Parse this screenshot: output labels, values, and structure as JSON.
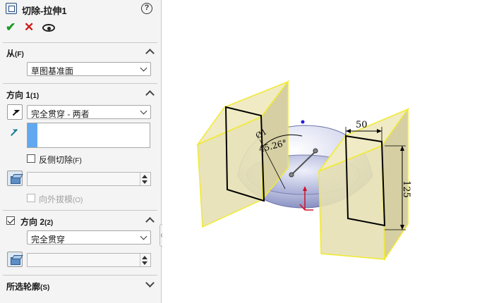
{
  "panel": {
    "title": "切除-拉伸1",
    "help_symbol": "?",
    "ok_symbol": "✔",
    "cancel_symbol": "✕",
    "from": {
      "label": "从",
      "shortcut": "(F)",
      "value": "草图基准面"
    },
    "direction1": {
      "label": "方向 1",
      "shortcut": "(1)",
      "end_condition": "完全贯穿 - 两者",
      "flip_side_label": "反侧切除",
      "flip_side_shortcut": "(F)",
      "flip_side_checked": false,
      "draft_outward_label": "向外拔模",
      "draft_outward_shortcut": "(O)",
      "draft_outward_enabled": false
    },
    "direction2": {
      "label": "方向 2",
      "shortcut": "(2)",
      "checked": true,
      "end_condition": "完全贯穿"
    },
    "selected_contours": {
      "label": "所选轮廓",
      "shortcut": "(S)"
    }
  },
  "viewport": {
    "dimensions": {
      "width": "50",
      "height": "125",
      "angle": "45.26°",
      "diameter_prefix": "Ø1"
    },
    "colors": {
      "block_fill": "#e9e3b8",
      "block_edge": "#f3ec3a",
      "sketch_line": "#000000",
      "dome_light": "#ffffff",
      "dome_dark": "#6f79b4",
      "triad_red": "#d0102a"
    }
  }
}
